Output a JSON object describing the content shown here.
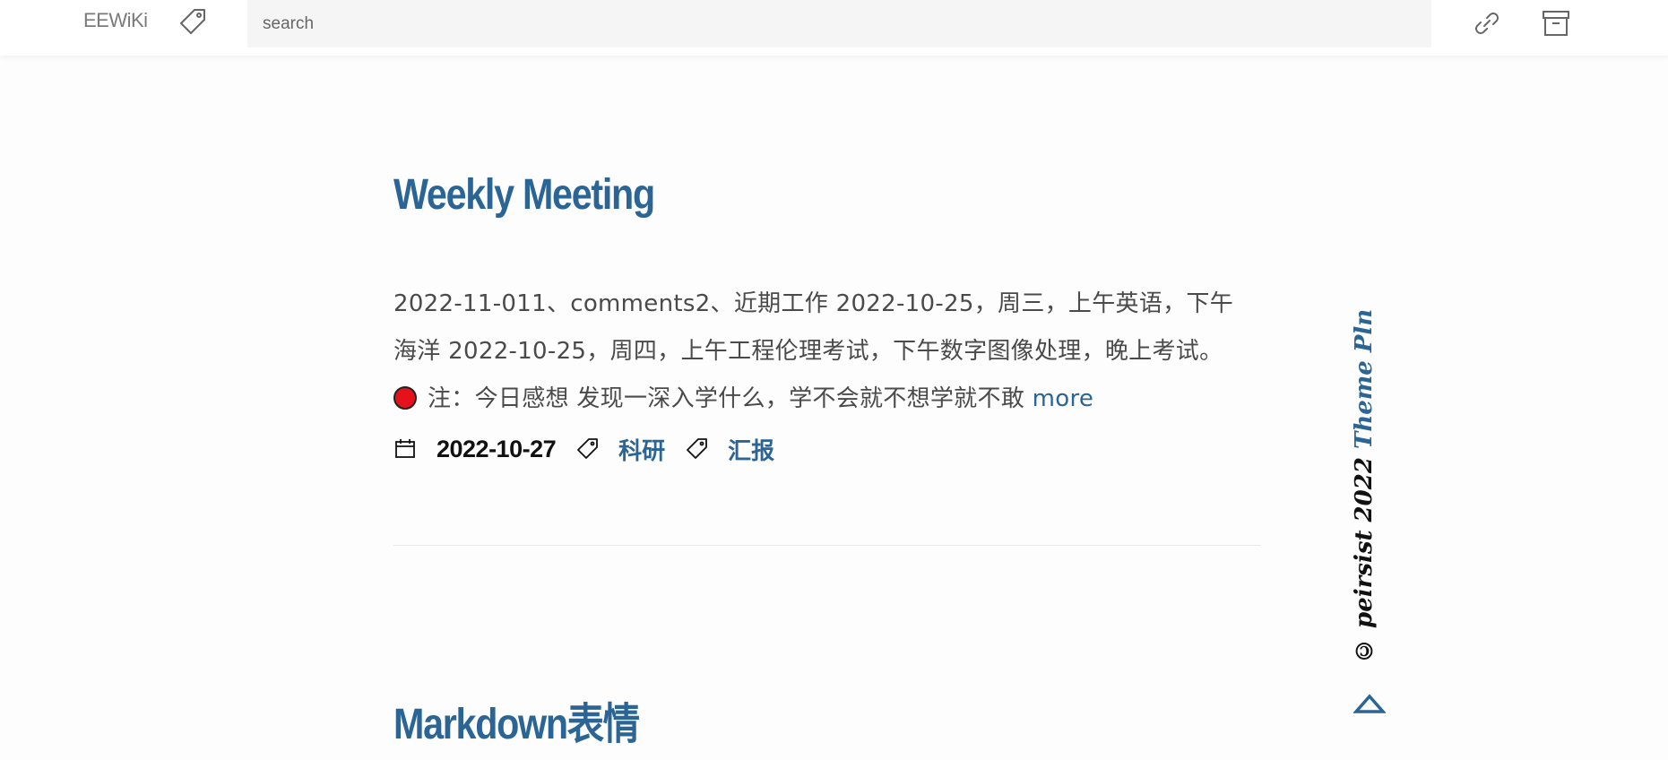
{
  "header": {
    "brand": "EEWiKi",
    "search_placeholder": "search"
  },
  "posts": [
    {
      "title": "Weekly Meeting",
      "excerpt_line1": "2022-11-011、comments2、近期工作 2022-10-25，周三，上午英语，下午",
      "excerpt_line2": "海洋 2022-10-25，周四，上午工程伦理考试，下午数字图像处理，晚上考试。",
      "excerpt_line3": "注：今日感想 发现一深入学什么，学不会就不想学就不敢",
      "more_label": "more",
      "date": "2022-10-27",
      "tags": [
        "科研",
        "汇报"
      ]
    },
    {
      "title": "Markdown表情"
    }
  ],
  "footer": {
    "copyright_prefix": "© peirsist 2022 ",
    "theme_label": "Theme Pln"
  },
  "colors": {
    "accent": "#2a6596",
    "dot": "#e5121c"
  },
  "icons": [
    "tag-icon",
    "link-icon",
    "archive-icon",
    "calendar-icon",
    "up-arrow-icon"
  ]
}
